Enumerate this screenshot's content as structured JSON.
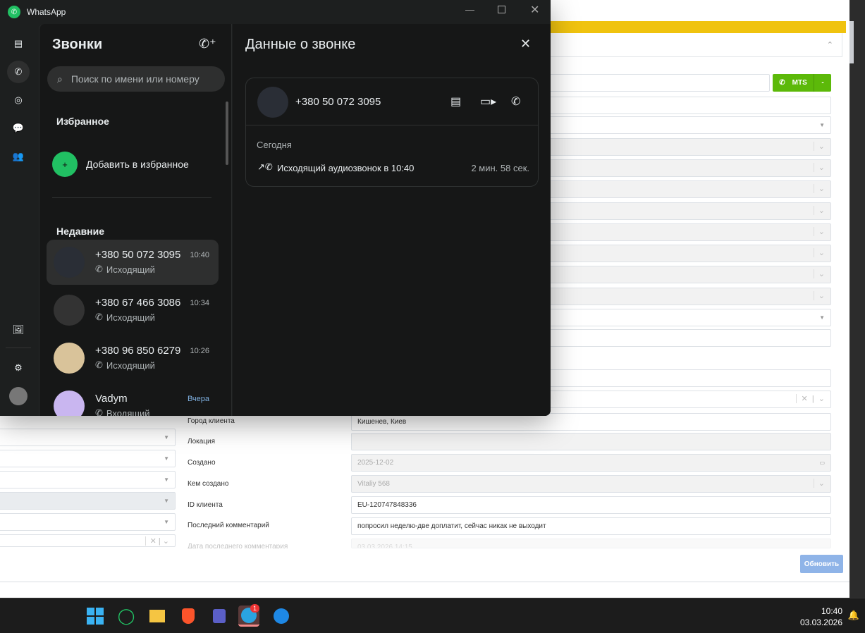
{
  "crm": {
    "call_button_label": "MTS",
    "fields": [
      {
        "label": "Город клиента",
        "value": "Кишенев, Киев"
      },
      {
        "label": "Локация",
        "value": ""
      },
      {
        "label": "Создано",
        "value": "2025-12-02"
      },
      {
        "label": "Кем создано",
        "value": "Vitaliy 568"
      },
      {
        "label": "ID клиента",
        "value": "EU-120747848336"
      },
      {
        "label": "Последний комментарий",
        "value": "попросил неделю-две доплатит, сейчас никак не выходит"
      },
      {
        "label": "Дата последнего комментария",
        "value": "03.03.2026 14:15"
      }
    ],
    "update_button": "Обновить",
    "accent_color": "#f0c30f"
  },
  "whatsapp": {
    "app_title": "WhatsApp",
    "calls_title": "Звонки",
    "search_placeholder": "Поиск по имени или номеру",
    "favorites_heading": "Избранное",
    "add_favorite": "Добавить в избранное",
    "recent_heading": "Недавние",
    "calls": [
      {
        "name": "+380 50 072 3095",
        "time": "10:40",
        "direction": "Исходящий",
        "avatar": "#2a2e36"
      },
      {
        "name": "+380 67 466 3086",
        "time": "10:34",
        "direction": "Исходящий",
        "avatar": "#333"
      },
      {
        "name": "+380 96 850 6279",
        "time": "10:26",
        "direction": "Исходящий",
        "avatar": "#d9c39a"
      },
      {
        "name": "Vadym",
        "time": "Вчера",
        "direction": "Входящий",
        "avatar": "#c9b6f0"
      }
    ],
    "detail": {
      "title": "Данные о звонке",
      "phone": "+380 50 072 3095",
      "day": "Сегодня",
      "call_text": "Исходящий аудиозвонок в 10:40",
      "duration": "2 мин. 58 сек."
    },
    "brand_color": "#21c063"
  },
  "taskbar": {
    "time": "10:40",
    "date": "03.03.2026",
    "telegram_badge": "1"
  }
}
